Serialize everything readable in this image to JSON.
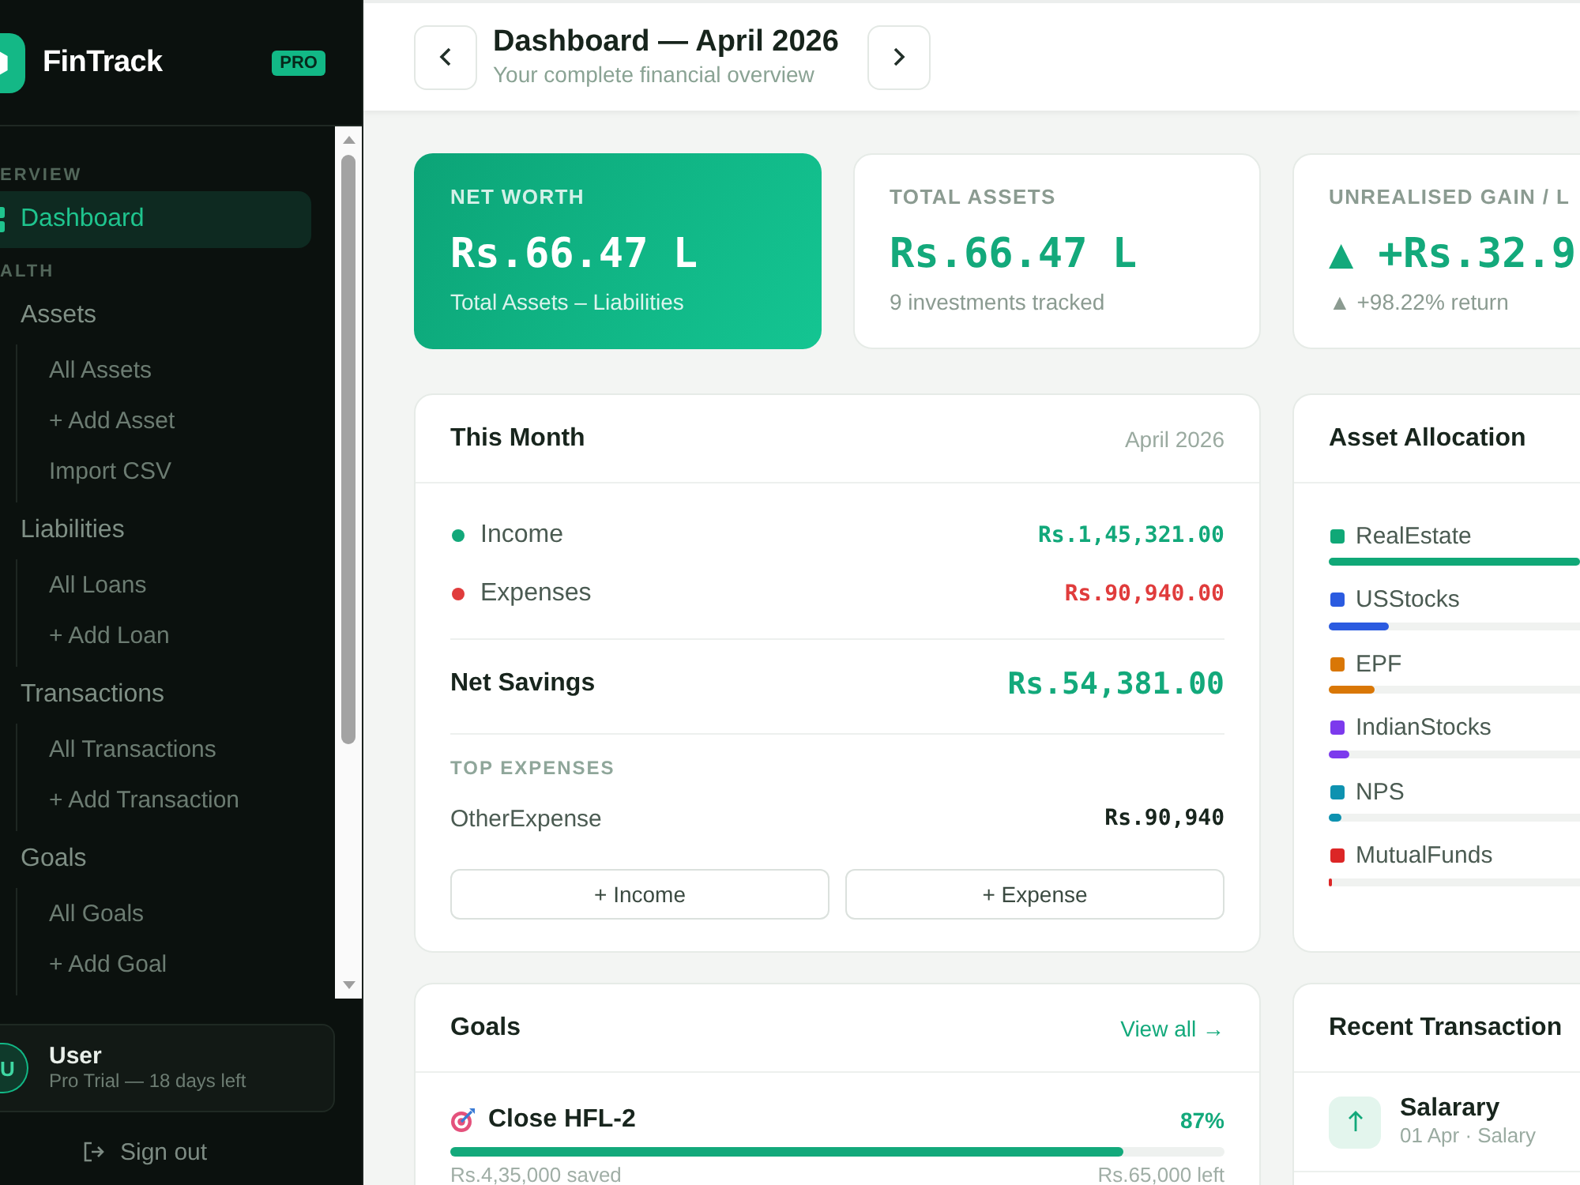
{
  "sidebar": {
    "brand": "FinTrack",
    "badge": "PRO",
    "sections": [
      {
        "label": "ERVIEW",
        "items": [
          {
            "label": "Dashboard",
            "selected": true
          }
        ]
      },
      {
        "label": "ALTH",
        "items": [
          {
            "label": "Assets",
            "selected": false,
            "children": [
              {
                "label": "All Assets",
                "selected": false
              },
              {
                "label": "+ Add Asset",
                "selected": false
              },
              {
                "label": "Import CSV",
                "selected": false
              }
            ]
          },
          {
            "label": "Liabilities",
            "selected": false,
            "children": [
              {
                "label": "All Loans",
                "selected": false
              },
              {
                "label": "+ Add Loan",
                "selected": false
              }
            ]
          },
          {
            "label": "Transactions",
            "selected": false,
            "children": [
              {
                "label": "All Transactions",
                "selected": false
              },
              {
                "label": "+ Add Transaction",
                "selected": false
              }
            ]
          },
          {
            "label": "Goals",
            "selected": false,
            "children": [
              {
                "label": "All Goals",
                "selected": false
              },
              {
                "label": "+ Add Goal",
                "selected": false
              }
            ]
          }
        ]
      }
    ],
    "user": {
      "initial": "U",
      "name": "User",
      "plan": "Pro Trial — 18 days left"
    },
    "sign_out": "Sign out"
  },
  "header": {
    "title": "Dashboard — April 2026",
    "subtitle": "Your complete financial overview"
  },
  "stats": [
    {
      "kind": "highlight",
      "label": "NET WORTH",
      "value": "Rs.66.47 L",
      "note": "Total Assets – Liabilities"
    },
    {
      "kind": "plain",
      "label": "TOTAL ASSETS",
      "value": "Rs.66.47 L",
      "note": "9 investments tracked"
    },
    {
      "kind": "plain",
      "label": "UNREALISED GAIN / L",
      "value": "▲ +Rs.32.9",
      "note": "▲ +98.22% return"
    }
  ],
  "this_month": {
    "title": "This Month",
    "period": "April 2026",
    "flows": [
      {
        "label": "Income",
        "amount": "Rs.1,45,321.00",
        "color": "#12a87a"
      },
      {
        "label": "Expenses",
        "amount": "Rs.90,940.00",
        "color": "#e03c3c"
      }
    ],
    "net": {
      "label": "Net Savings",
      "amount": "Rs.54,381.00"
    },
    "top_expenses_title": "TOP EXPENSES",
    "top_expenses": [
      {
        "label": "OtherExpense",
        "amount": "Rs.90,940"
      }
    ],
    "buttons": [
      "+ Income",
      "+ Expense"
    ]
  },
  "allocation": {
    "title": "Asset Allocation",
    "items": [
      {
        "label": "RealEstate",
        "color": "#10a877",
        "level": 1
      },
      {
        "label": "USStocks",
        "color": "#2b5be0",
        "level": 0.24
      },
      {
        "label": "EPF",
        "color": "#d97706",
        "level": 0.18
      },
      {
        "label": "IndianStocks",
        "color": "#7c3aed",
        "level": 0.08
      },
      {
        "label": "NPS",
        "color": "#0e92b0",
        "level": 0.05
      },
      {
        "label": "MutualFunds",
        "color": "#dc2626",
        "level": 0.01
      }
    ]
  },
  "goals": {
    "title": "Goals",
    "link": "View all →",
    "items": [
      {
        "name": "Close HFL-2",
        "percent": "87%",
        "level": 0.87,
        "saved": "Rs.4,35,000 saved",
        "left": "Rs.65,000 left"
      }
    ]
  },
  "transactions": {
    "title": "Recent Transaction",
    "items": [
      {
        "kind": "income",
        "name": "Salarary",
        "meta": "01 Apr · Salary"
      }
    ]
  }
}
